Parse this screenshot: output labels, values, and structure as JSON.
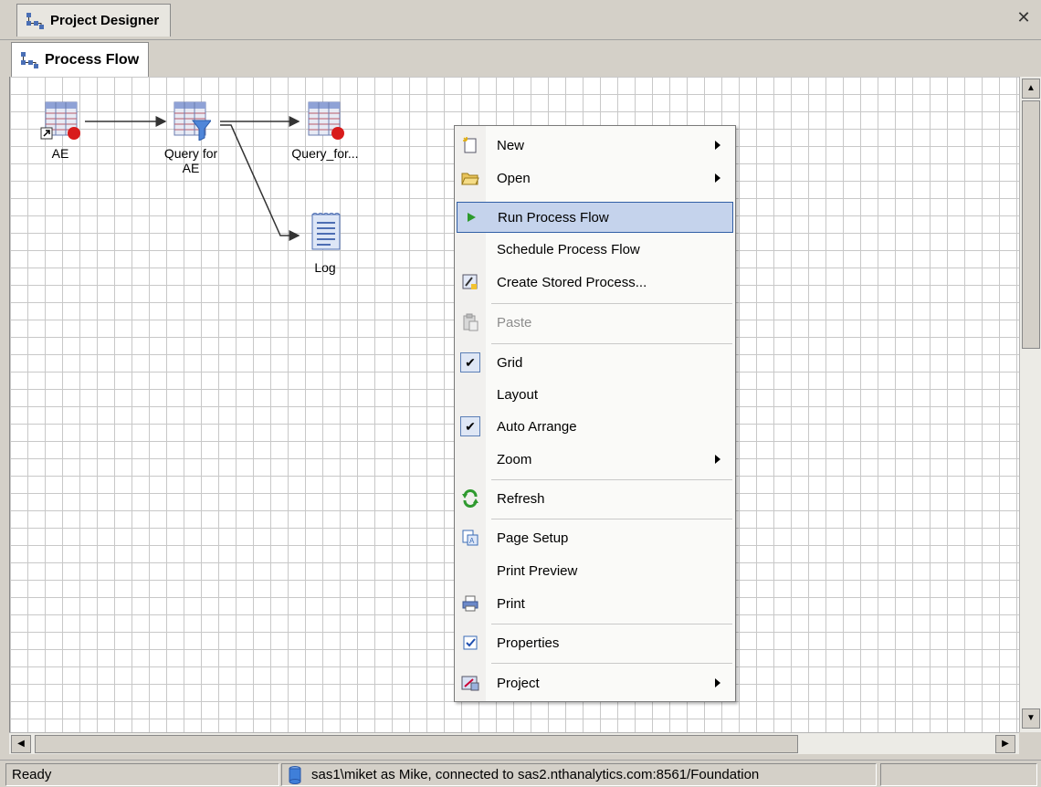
{
  "window": {
    "tab_label": "Project Designer",
    "close_glyph": "✕"
  },
  "subtab": {
    "label": "Process Flow"
  },
  "nodes": [
    {
      "label": "AE",
      "icon": "data-table-shortcut-icon"
    },
    {
      "label": "Query for AE",
      "icon": "query-filter-icon"
    },
    {
      "label": "Query_for...",
      "icon": "data-table-icon"
    },
    {
      "label": "Log",
      "icon": "log-document-icon"
    }
  ],
  "context_menu": {
    "items": [
      {
        "label": "New",
        "icon": "new-icon",
        "submenu": true
      },
      {
        "label": "Open",
        "icon": "open-folder-icon",
        "submenu": true
      },
      {
        "label": "Run Process Flow",
        "icon": "run-icon",
        "highlighted": true
      },
      {
        "label": "Schedule Process Flow"
      },
      {
        "label": "Create Stored Process...",
        "icon": "stored-process-icon"
      },
      {
        "label": "Paste",
        "icon": "paste-icon",
        "disabled": true
      },
      {
        "label": "Grid",
        "checked": true
      },
      {
        "label": "Layout"
      },
      {
        "label": "Auto Arrange",
        "checked": true
      },
      {
        "label": "Zoom",
        "submenu": true
      },
      {
        "label": "Refresh",
        "icon": "refresh-icon"
      },
      {
        "label": "Page Setup",
        "icon": "page-setup-icon"
      },
      {
        "label": "Print Preview"
      },
      {
        "label": "Print",
        "icon": "printer-icon"
      },
      {
        "label": "Properties",
        "icon": "properties-icon"
      },
      {
        "label": "Project",
        "icon": "project-icon",
        "submenu": true
      }
    ]
  },
  "status": {
    "left": "Ready",
    "connection": "sas1\\miket as Mike, connected to sas2.nthanalytics.com:8561/Foundation"
  },
  "colors": {
    "highlight_bg": "#c5d3ec",
    "highlight_border": "#315fa6",
    "grid_line": "#c8c8c8"
  }
}
